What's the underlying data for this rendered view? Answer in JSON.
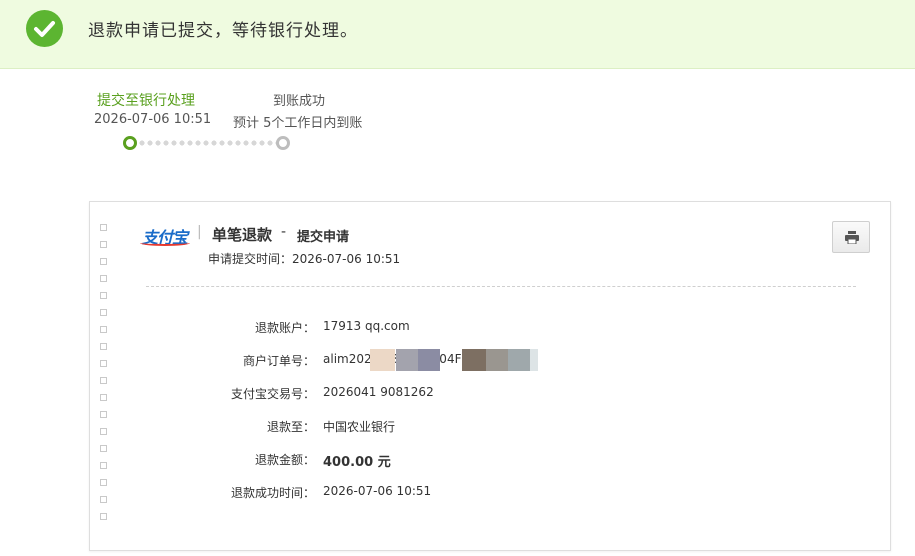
{
  "banner": {
    "message": "退款申请已提交，等待银行处理。",
    "icon": "check-circle-icon",
    "accent": "#5cb531"
  },
  "steps": [
    {
      "title": "提交至银行处理",
      "time": "2026-07-06 10:51",
      "state": "done"
    },
    {
      "title": "到账成功",
      "time": "预计 5个工作日内到账",
      "state": "pending"
    }
  ],
  "card": {
    "logo": "支付宝",
    "separator": "|",
    "title": "单笔退款",
    "dash": "-",
    "subtitle": "提交申请",
    "submit_label": "申请提交时间：",
    "submit_time": "2026-07-06 10:51",
    "print_icon": "print-icon",
    "rows": [
      {
        "label": "退款账户：",
        "value": "17913          qq.com"
      },
      {
        "label": "商户订单号：",
        "value": "alim2026                                       38BB95D04F4"
      },
      {
        "label": "支付宝交易号：",
        "value": "2026041                    9081262"
      },
      {
        "label": "退款至：",
        "value": "中国农业银行"
      },
      {
        "label": "退款金额：",
        "value": "400.00 元"
      },
      {
        "label": "退款成功时间：",
        "value": "2026-07-06 10:51"
      }
    ]
  }
}
